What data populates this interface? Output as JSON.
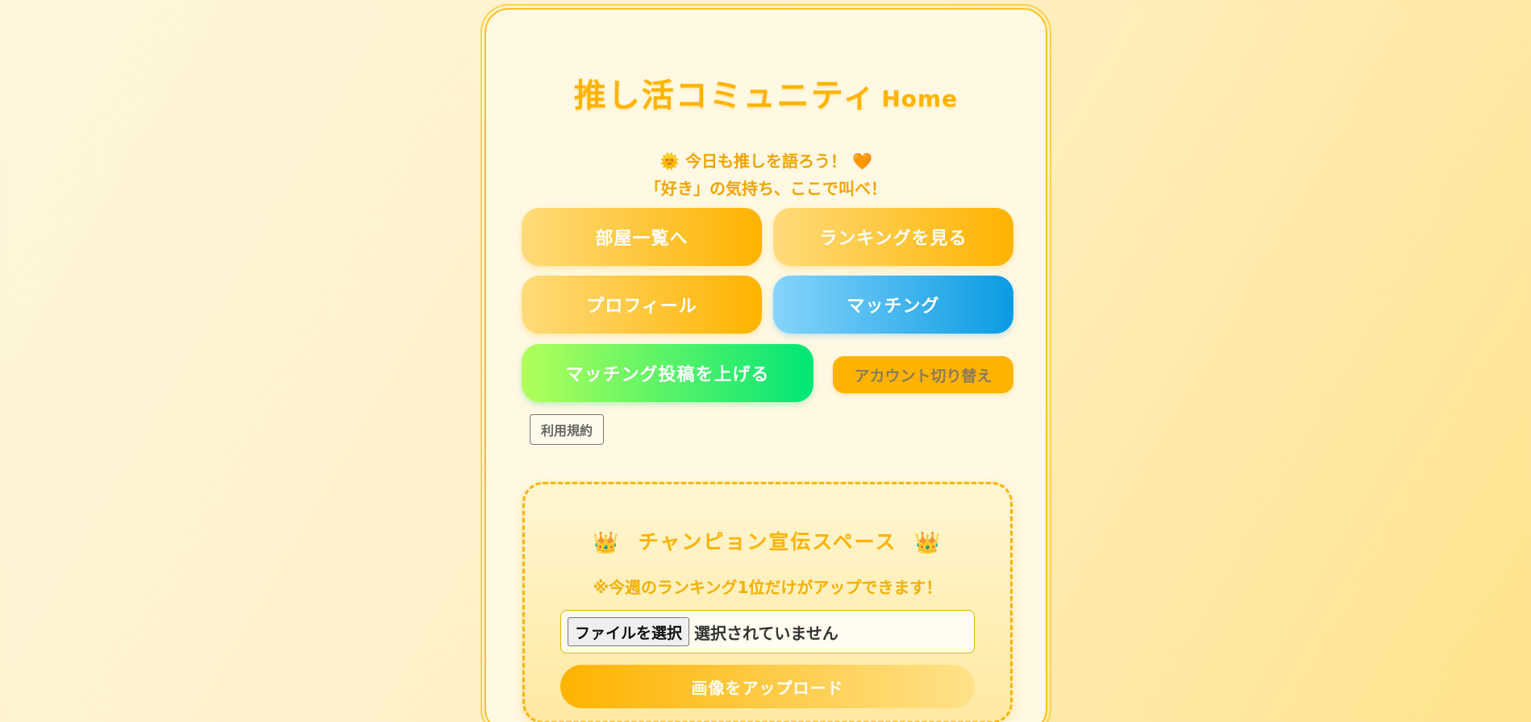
{
  "header": {
    "title": "推し活コミュニティ",
    "title_suffix": "Home",
    "tagline": "🌞 今日も推しを語ろう！ 🧡",
    "subtagline": "「好き」の気持ち、ここで叫べ！"
  },
  "nav": {
    "rooms": "部屋一覧へ",
    "ranking": "ランキングを見る",
    "profile": "プロフィール",
    "matching": "マッチング",
    "post_matching": "マッチング投稿を上げる",
    "switch_account": "アカウント切り替え",
    "terms": "利用規約"
  },
  "champion": {
    "crown_left": "👑",
    "crown_right": "👑",
    "title": "チャンピョン宣伝スペース",
    "note": "※今週のランキング1位だけがアップできます！",
    "file_button": "ファイルを選択",
    "file_status": "選択されていません",
    "upload_label": "画像をアップロード"
  }
}
